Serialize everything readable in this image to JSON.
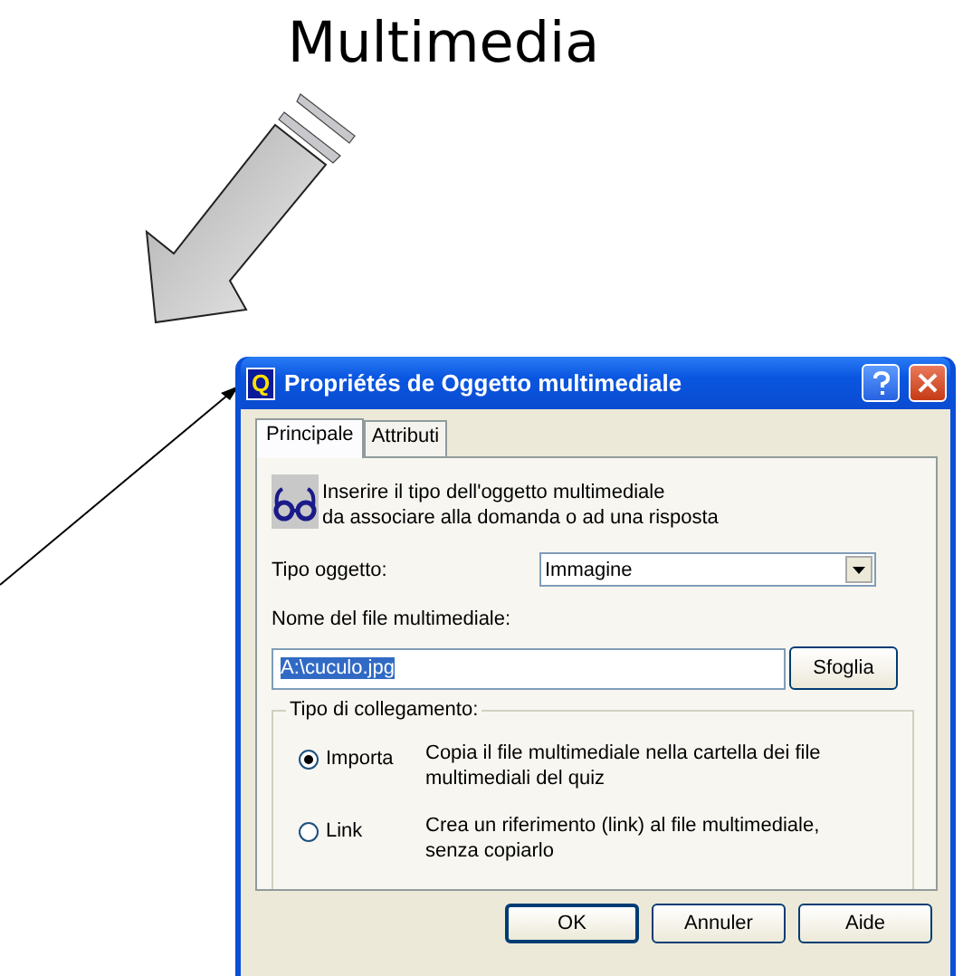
{
  "heading": "Multimedia",
  "window": {
    "title": "Propriétés de Oggetto multimediale",
    "app_icon": "Q"
  },
  "tabs": [
    {
      "label": "Principale",
      "selected": true
    },
    {
      "label": "Attributi",
      "selected": false
    }
  ],
  "info": {
    "lines": [
      "Inserire il tipo dell'oggetto multimediale",
      "da associare alla domanda o ad una risposta"
    ]
  },
  "object_type": {
    "label": "Tipo oggetto:",
    "value": "Immagine"
  },
  "file_name": {
    "label": "Nome del file multimediale:",
    "value": "A:\\cuculo.jpg",
    "browse": "Sfoglia"
  },
  "link_type": {
    "title": "Tipo di collegamento:",
    "options": [
      {
        "label": "Importa",
        "selected": true,
        "description": [
          "Copia il file multimediale nella cartella dei file",
          "multimediali del quiz"
        ]
      },
      {
        "label": "Link",
        "selected": false,
        "description": [
          "Crea un riferimento (link) al file multimediale,",
          "senza copiarlo"
        ]
      }
    ]
  },
  "buttons": [
    "OK",
    "Annuler",
    "Aide"
  ]
}
